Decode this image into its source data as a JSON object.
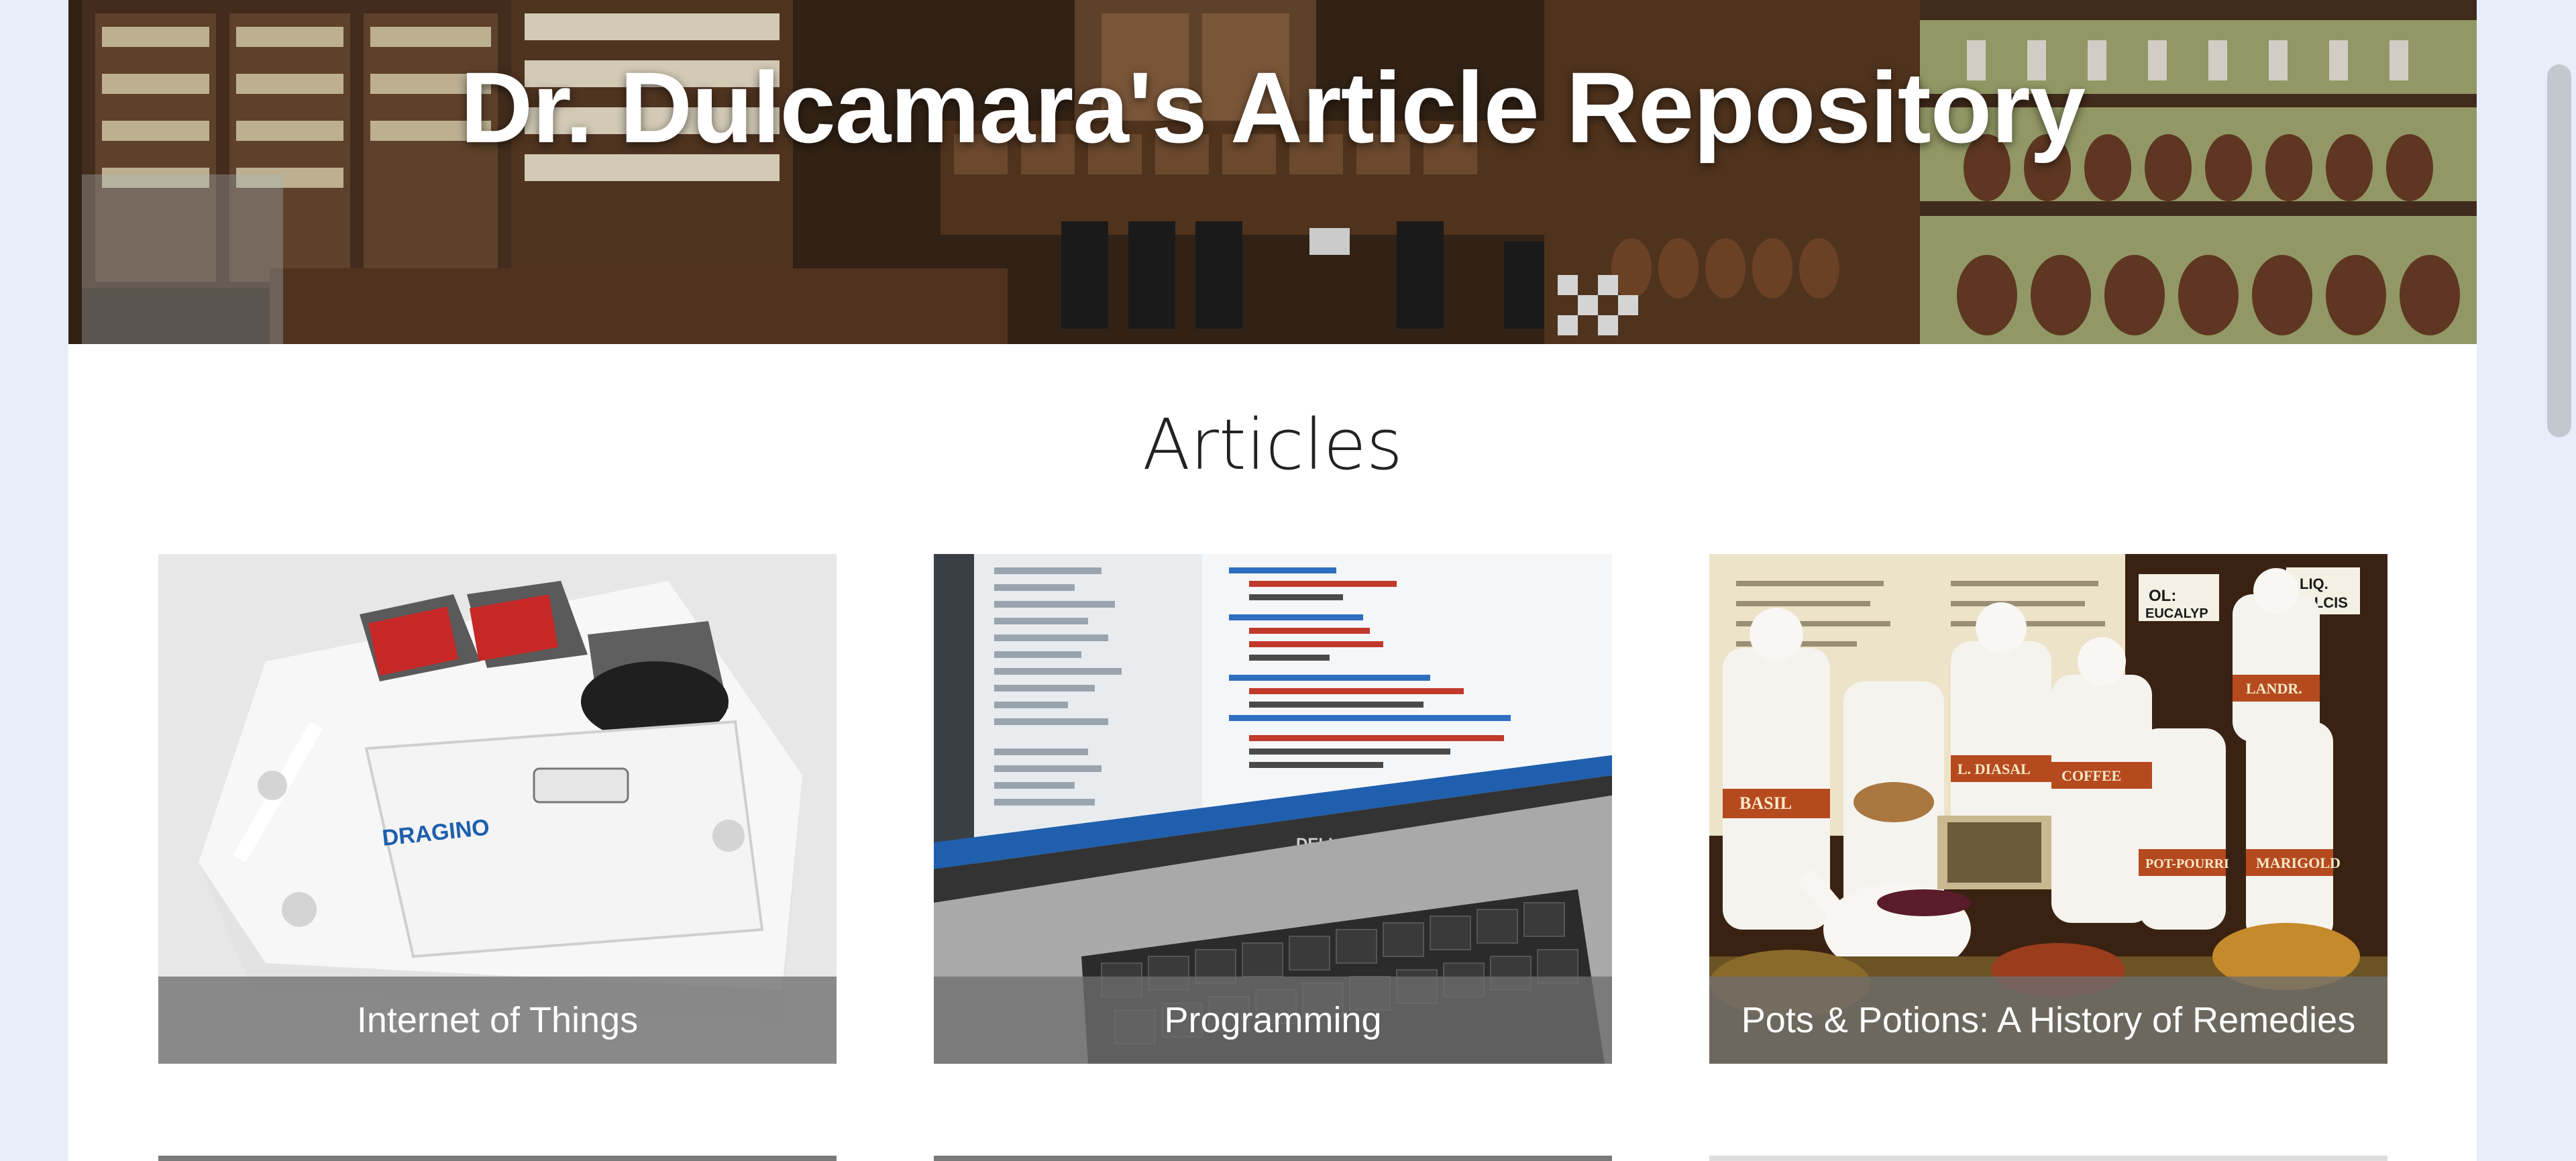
{
  "site": {
    "title": "Dr. Dulcamara's Article Repository"
  },
  "articles": {
    "heading": "Articles",
    "items": [
      {
        "label": "Internet of Things"
      },
      {
        "label": "Programming"
      },
      {
        "label": "Pots & Potions: A History of Remedies"
      }
    ]
  },
  "colors": {
    "page_background": "#e8eef9",
    "content_background": "#ffffff",
    "caption_overlay": "#6e6e6e",
    "scrollbar_thumb": "#c3c7cf"
  }
}
